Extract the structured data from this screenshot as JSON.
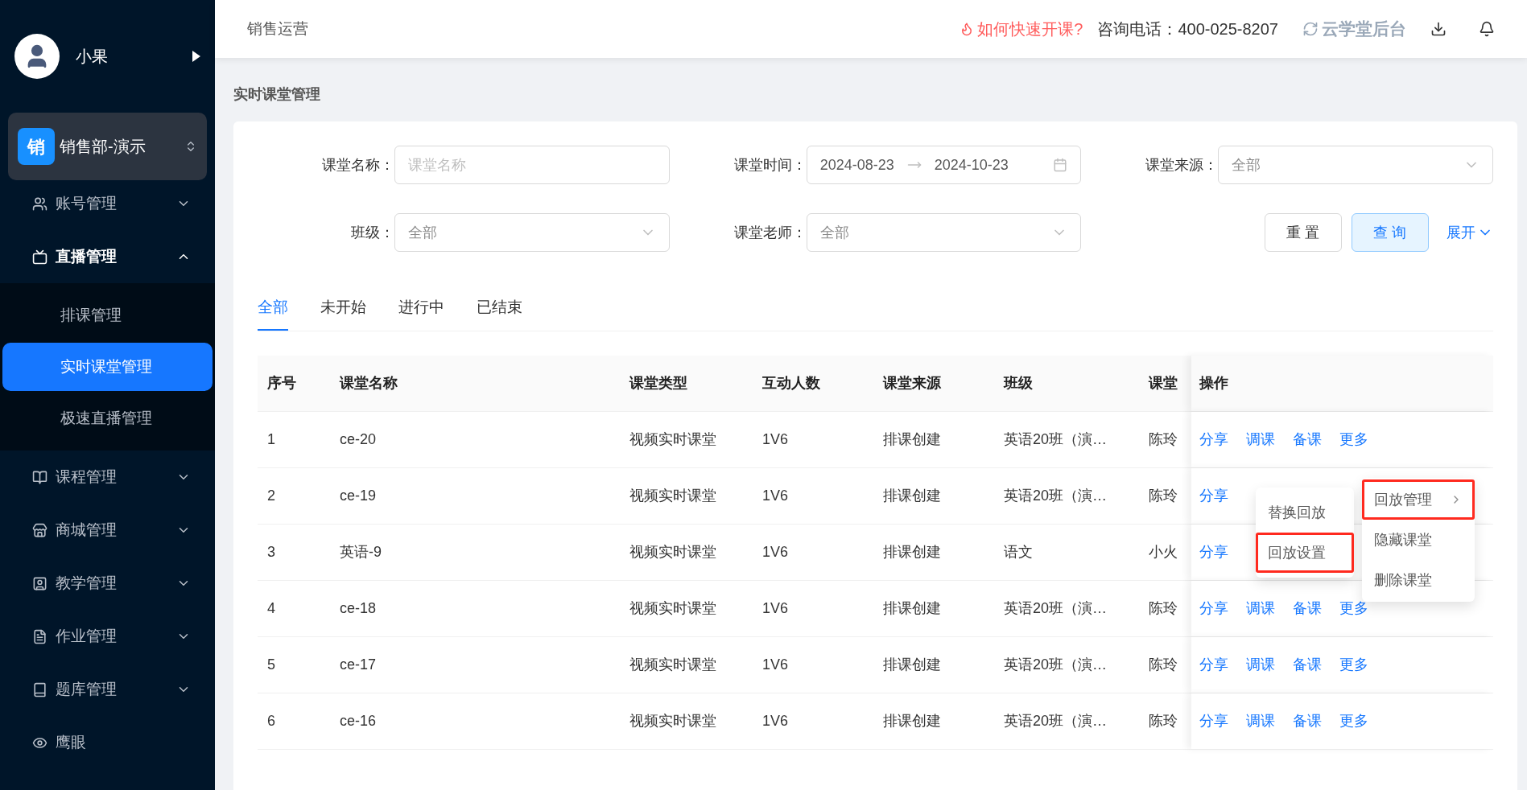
{
  "user": {
    "name": "小果"
  },
  "org": {
    "badge": "销",
    "name": "销售部-演示"
  },
  "nav": [
    {
      "kind": "group",
      "label": "账号管理",
      "expanded": false
    },
    {
      "kind": "group",
      "label": "直播管理",
      "expanded": true,
      "children": [
        {
          "label": "排课管理",
          "selected": false
        },
        {
          "label": "实时课堂管理",
          "selected": true
        },
        {
          "label": "极速直播管理",
          "selected": false
        }
      ]
    },
    {
      "kind": "group",
      "label": "课程管理",
      "expanded": false
    },
    {
      "kind": "group",
      "label": "商城管理",
      "expanded": false
    },
    {
      "kind": "group",
      "label": "教学管理",
      "expanded": false
    },
    {
      "kind": "group",
      "label": "作业管理",
      "expanded": false
    },
    {
      "kind": "group",
      "label": "题库管理",
      "expanded": false
    },
    {
      "kind": "link",
      "label": "鹰眼"
    }
  ],
  "header": {
    "section": "销售运营",
    "help_link": "如何快速开课?",
    "hotline": "咨询电话：400-025-8207",
    "brand": "云学堂后台"
  },
  "page_title": "实时课堂管理",
  "filters": [
    {
      "kind": "text",
      "label": "课堂名称：",
      "placeholder": "课堂名称"
    },
    {
      "kind": "daterange",
      "label": "课堂时间：",
      "start": "2024-08-23",
      "end": "2024-10-23"
    },
    {
      "kind": "select",
      "label": "课堂来源：",
      "value": "全部"
    },
    {
      "kind": "select",
      "label": "班级：",
      "value": "全部"
    },
    {
      "kind": "select",
      "label": "课堂老师：",
      "value": "全部"
    }
  ],
  "actions": {
    "reset": "重 置",
    "query": "查 询",
    "expand": "展开"
  },
  "tabs": [
    {
      "label": "全部",
      "selected": true
    },
    {
      "label": "未开始",
      "selected": false
    },
    {
      "label": "进行中",
      "selected": false
    },
    {
      "label": "已结束",
      "selected": false
    }
  ],
  "table": {
    "columns": [
      "序号",
      "课堂名称",
      "课堂类型",
      "互动人数",
      "课堂来源",
      "班级",
      "课堂",
      "操作"
    ],
    "rows": [
      {
        "cells": [
          "1",
          "ce-20",
          "视频实时课堂",
          "1V6",
          "排课创建",
          "英语20班（演…",
          "陈玲"
        ],
        "actions": [
          "分享",
          "调课",
          "备课",
          "更多"
        ]
      },
      {
        "cells": [
          "2",
          "ce-19",
          "视频实时课堂",
          "1V6",
          "排课创建",
          "英语20班（演…",
          "陈玲"
        ],
        "actions": [
          "分享"
        ]
      },
      {
        "cells": [
          "3",
          "英语-9",
          "视频实时课堂",
          "1V6",
          "排课创建",
          "语文",
          "小火"
        ],
        "actions": [
          "分享"
        ]
      },
      {
        "cells": [
          "4",
          "ce-18",
          "视频实时课堂",
          "1V6",
          "排课创建",
          "英语20班（演…",
          "陈玲"
        ],
        "actions": [
          "分享",
          "调课",
          "备课",
          "更多"
        ]
      },
      {
        "cells": [
          "5",
          "ce-17",
          "视频实时课堂",
          "1V6",
          "排课创建",
          "英语20班（演…",
          "陈玲"
        ],
        "actions": [
          "分享",
          "调课",
          "备课",
          "更多"
        ]
      },
      {
        "cells": [
          "6",
          "ce-16",
          "视频实时课堂",
          "1V6",
          "排课创建",
          "英语20班（演…",
          "陈玲"
        ],
        "actions": [
          "分享",
          "调课",
          "备课",
          "更多"
        ]
      }
    ]
  },
  "dropdown": {
    "items": [
      {
        "label": "回放管理",
        "has_submenu": true,
        "highlighted": true
      },
      {
        "label": "隐藏课堂",
        "has_submenu": false,
        "highlighted": false
      },
      {
        "label": "删除课堂",
        "has_submenu": false,
        "highlighted": false
      }
    ],
    "submenu": [
      {
        "label": "替换回放",
        "highlighted": false
      },
      {
        "label": "回放设置",
        "highlighted": true
      }
    ]
  }
}
